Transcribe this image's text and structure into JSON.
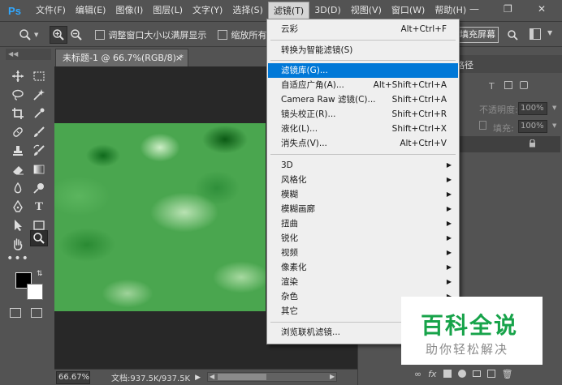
{
  "app": {
    "logo": "Ps",
    "brand_color": "#31a8ff"
  },
  "menubar": {
    "items": [
      "文件(F)",
      "编辑(E)",
      "图像(I)",
      "图层(L)",
      "文字(Y)",
      "选择(S)",
      "滤镜(T)",
      "3D(D)",
      "视图(V)",
      "窗口(W)",
      "帮助(H)"
    ],
    "active_index": 6,
    "window_controls": [
      "minimize-icon",
      "restore-icon",
      "close-icon"
    ]
  },
  "options": {
    "checkbox1_label": "调整窗口大小以满屏显示",
    "checkbox2_label": "缩放所有",
    "fill_button": "填充屏幕"
  },
  "document": {
    "tab_title": "未标题-1 @ 66.7%(RGB/8) *",
    "zoom": "66.67%",
    "doc_info": "文档:937.5K/937.5K"
  },
  "panels": {
    "tab_label": "路径",
    "opacity_label": "不透明度:",
    "opacity_value": "100%",
    "fill_label": "填充:",
    "fill_value": "100%"
  },
  "filter_menu": {
    "items": [
      {
        "label": "云彩",
        "shortcut": "Alt+Ctrl+F"
      },
      {
        "label": "转换为智能滤镜(S)",
        "shortcut": ""
      },
      {
        "label": "滤镜库(G)...",
        "shortcut": ""
      },
      {
        "label": "自适应广角(A)...",
        "shortcut": "Alt+Shift+Ctrl+A"
      },
      {
        "label": "Camera Raw 滤镜(C)...",
        "shortcut": "Shift+Ctrl+A"
      },
      {
        "label": "镜头校正(R)...",
        "shortcut": "Shift+Ctrl+R"
      },
      {
        "label": "液化(L)...",
        "shortcut": "Shift+Ctrl+X"
      },
      {
        "label": "消失点(V)...",
        "shortcut": "Alt+Ctrl+V"
      },
      {
        "label": "3D",
        "shortcut": ""
      },
      {
        "label": "风格化",
        "shortcut": ""
      },
      {
        "label": "模糊",
        "shortcut": ""
      },
      {
        "label": "模糊画廊",
        "shortcut": ""
      },
      {
        "label": "扭曲",
        "shortcut": ""
      },
      {
        "label": "锐化",
        "shortcut": ""
      },
      {
        "label": "视频",
        "shortcut": ""
      },
      {
        "label": "像素化",
        "shortcut": ""
      },
      {
        "label": "渲染",
        "shortcut": ""
      },
      {
        "label": "杂色",
        "shortcut": ""
      },
      {
        "label": "其它",
        "shortcut": ""
      },
      {
        "label": "浏览联机滤镜...",
        "shortcut": ""
      }
    ],
    "highlighted_index": 2,
    "highlight_color": "#0078d7"
  },
  "watermark": {
    "title": "百科全说",
    "subtitle": "助你轻松解决",
    "title_color": "#17a34a"
  }
}
